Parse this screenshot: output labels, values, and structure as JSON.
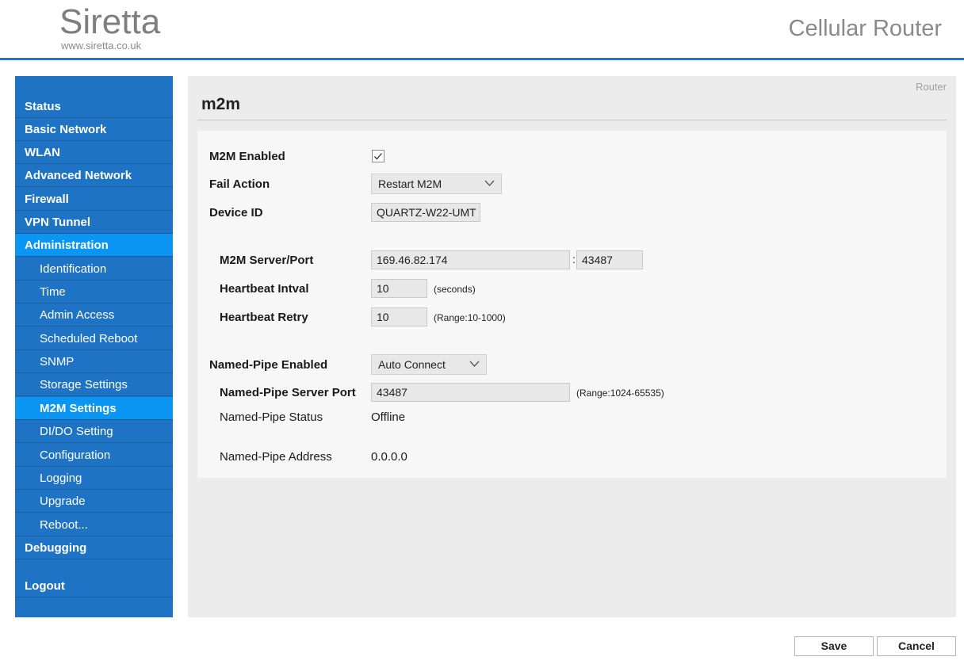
{
  "header": {
    "logo_text": "Siretta",
    "logo_url": "www.siretta.co.uk",
    "product_title": "Cellular Router"
  },
  "sidebar": {
    "items": [
      {
        "label": "Status",
        "level": "top"
      },
      {
        "label": "Basic Network",
        "level": "top"
      },
      {
        "label": "WLAN",
        "level": "top"
      },
      {
        "label": "Advanced Network",
        "level": "top"
      },
      {
        "label": "Firewall",
        "level": "top"
      },
      {
        "label": "VPN Tunnel",
        "level": "top"
      },
      {
        "label": "Administration",
        "level": "top",
        "active": true
      },
      {
        "label": "Identification",
        "level": "sub"
      },
      {
        "label": "Time",
        "level": "sub"
      },
      {
        "label": "Admin Access",
        "level": "sub"
      },
      {
        "label": "Scheduled Reboot",
        "level": "sub"
      },
      {
        "label": "SNMP",
        "level": "sub"
      },
      {
        "label": "Storage Settings",
        "level": "sub"
      },
      {
        "label": "M2M Settings",
        "level": "sub",
        "active": true
      },
      {
        "label": "DI/DO Setting",
        "level": "sub"
      },
      {
        "label": "Configuration",
        "level": "sub"
      },
      {
        "label": "Logging",
        "level": "sub"
      },
      {
        "label": "Upgrade",
        "level": "sub"
      },
      {
        "label": "Reboot...",
        "level": "sub"
      },
      {
        "label": "Debugging",
        "level": "top"
      },
      {
        "label": "Logout",
        "level": "top"
      }
    ]
  },
  "main": {
    "breadcrumb": "Router",
    "title": "m2m",
    "form": {
      "m2m_enabled": {
        "label": "M2M Enabled",
        "checked": true
      },
      "fail_action": {
        "label": "Fail Action",
        "value": "Restart M2M"
      },
      "device_id": {
        "label": "Device ID",
        "value": "QUARTZ-W22-UMT"
      },
      "server_port": {
        "label": "M2M Server/Port",
        "server": "169.46.82.174",
        "separator": ":",
        "port": "43487"
      },
      "heartbeat_intval": {
        "label": "Heartbeat Intval",
        "value": "10",
        "hint": "(seconds)"
      },
      "heartbeat_retry": {
        "label": "Heartbeat Retry",
        "value": "10",
        "hint": "(Range:10-1000)"
      },
      "named_pipe_enabled": {
        "label": "Named-Pipe Enabled",
        "value": "Auto Connect"
      },
      "named_pipe_server_port": {
        "label": "Named-Pipe Server Port",
        "value": "43487",
        "hint": "(Range:1024-65535)"
      },
      "named_pipe_status": {
        "label": "Named-Pipe Status",
        "value": "Offline"
      },
      "named_pipe_address": {
        "label": "Named-Pipe Address",
        "value": "0.0.0.0"
      }
    }
  },
  "footer": {
    "save_label": "Save",
    "cancel_label": "Cancel"
  },
  "colors": {
    "sidebar_bg": "#1e73c5",
    "sidebar_active": "#0a96f2",
    "header_rule": "#2a73c4"
  }
}
